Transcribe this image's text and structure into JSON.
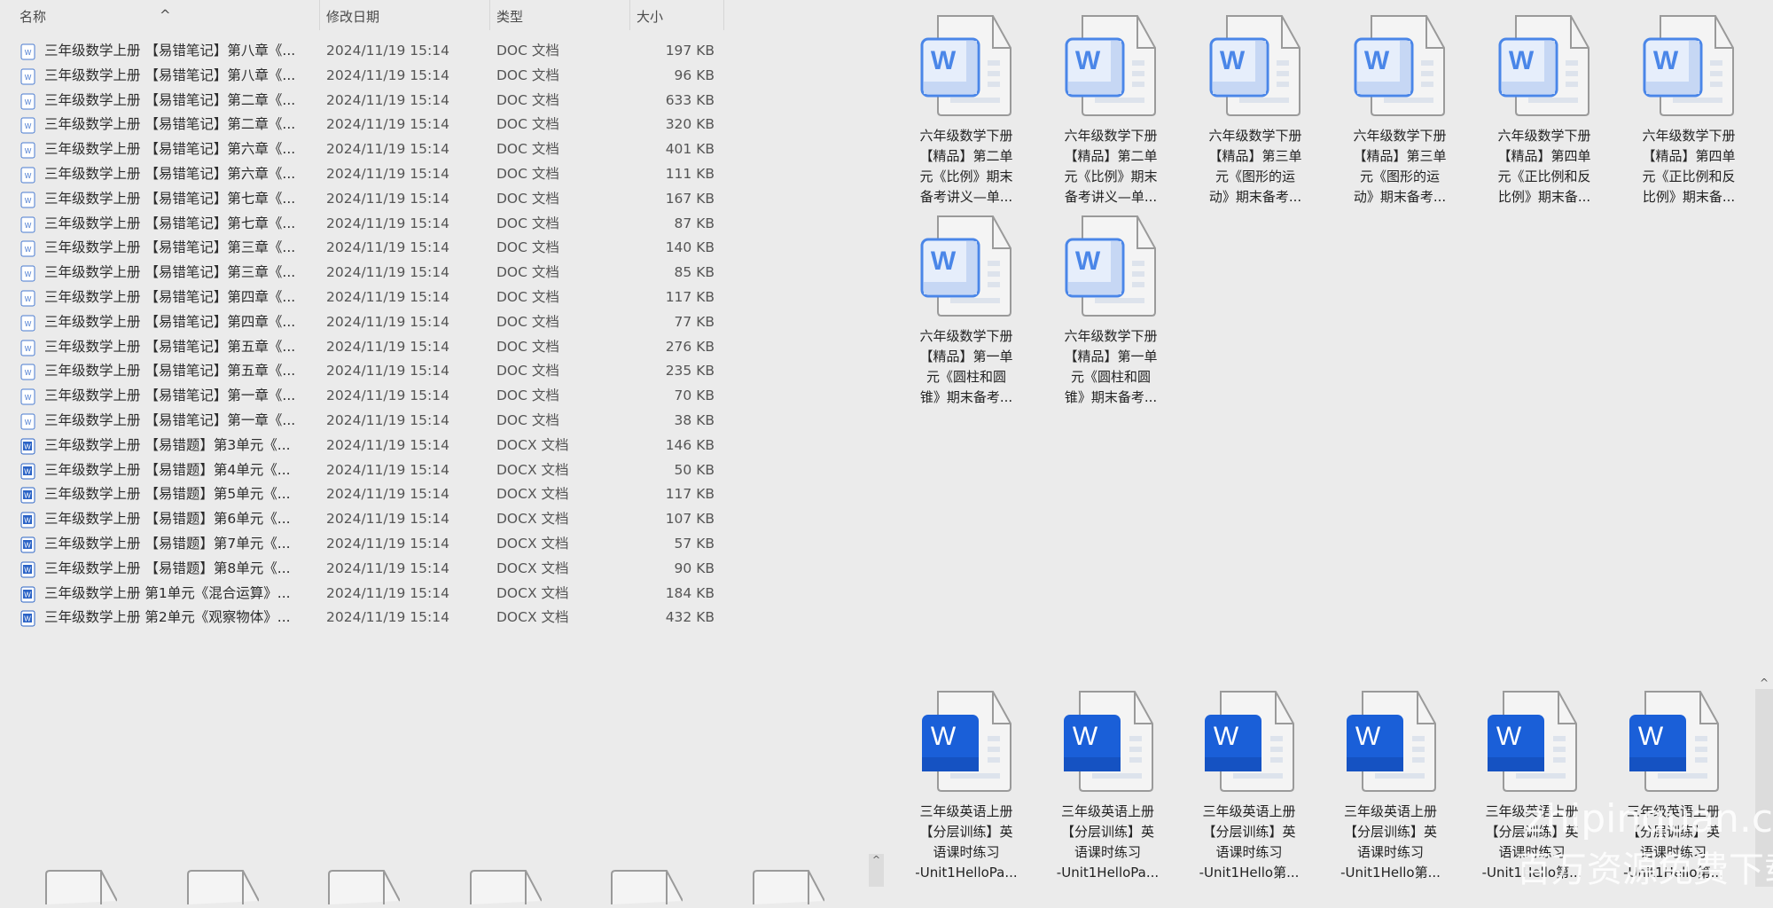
{
  "list": {
    "columns": {
      "name": "名称",
      "date": "修改日期",
      "type": "类型",
      "size": "大小"
    },
    "rows": [
      {
        "name": "三年级数学上册 【易错笔记】第八章《...",
        "date": "2024/11/19 15:14",
        "type": "DOC 文档",
        "size": "197 KB",
        "kind": "doc"
      },
      {
        "name": "三年级数学上册 【易错笔记】第八章《...",
        "date": "2024/11/19 15:14",
        "type": "DOC 文档",
        "size": "96 KB",
        "kind": "doc"
      },
      {
        "name": "三年级数学上册 【易错笔记】第二章《...",
        "date": "2024/11/19 15:14",
        "type": "DOC 文档",
        "size": "633 KB",
        "kind": "doc"
      },
      {
        "name": "三年级数学上册 【易错笔记】第二章《...",
        "date": "2024/11/19 15:14",
        "type": "DOC 文档",
        "size": "320 KB",
        "kind": "doc"
      },
      {
        "name": "三年级数学上册 【易错笔记】第六章《...",
        "date": "2024/11/19 15:14",
        "type": "DOC 文档",
        "size": "401 KB",
        "kind": "doc"
      },
      {
        "name": "三年级数学上册 【易错笔记】第六章《...",
        "date": "2024/11/19 15:14",
        "type": "DOC 文档",
        "size": "111 KB",
        "kind": "doc"
      },
      {
        "name": "三年级数学上册 【易错笔记】第七章《...",
        "date": "2024/11/19 15:14",
        "type": "DOC 文档",
        "size": "167 KB",
        "kind": "doc"
      },
      {
        "name": "三年级数学上册 【易错笔记】第七章《...",
        "date": "2024/11/19 15:14",
        "type": "DOC 文档",
        "size": "87 KB",
        "kind": "doc"
      },
      {
        "name": "三年级数学上册 【易错笔记】第三章《...",
        "date": "2024/11/19 15:14",
        "type": "DOC 文档",
        "size": "140 KB",
        "kind": "doc"
      },
      {
        "name": "三年级数学上册 【易错笔记】第三章《...",
        "date": "2024/11/19 15:14",
        "type": "DOC 文档",
        "size": "85 KB",
        "kind": "doc"
      },
      {
        "name": "三年级数学上册 【易错笔记】第四章《...",
        "date": "2024/11/19 15:14",
        "type": "DOC 文档",
        "size": "117 KB",
        "kind": "doc"
      },
      {
        "name": "三年级数学上册 【易错笔记】第四章《...",
        "date": "2024/11/19 15:14",
        "type": "DOC 文档",
        "size": "77 KB",
        "kind": "doc"
      },
      {
        "name": "三年级数学上册 【易错笔记】第五章《...",
        "date": "2024/11/19 15:14",
        "type": "DOC 文档",
        "size": "276 KB",
        "kind": "doc"
      },
      {
        "name": "三年级数学上册 【易错笔记】第五章《...",
        "date": "2024/11/19 15:14",
        "type": "DOC 文档",
        "size": "235 KB",
        "kind": "doc"
      },
      {
        "name": "三年级数学上册 【易错笔记】第一章《...",
        "date": "2024/11/19 15:14",
        "type": "DOC 文档",
        "size": "70 KB",
        "kind": "doc"
      },
      {
        "name": "三年级数学上册 【易错笔记】第一章《...",
        "date": "2024/11/19 15:14",
        "type": "DOC 文档",
        "size": "38 KB",
        "kind": "doc"
      },
      {
        "name": "三年级数学上册 【易错题】第3单元《...",
        "date": "2024/11/19 15:14",
        "type": "DOCX 文档",
        "size": "146 KB",
        "kind": "docx"
      },
      {
        "name": "三年级数学上册 【易错题】第4单元《...",
        "date": "2024/11/19 15:14",
        "type": "DOCX 文档",
        "size": "50 KB",
        "kind": "docx"
      },
      {
        "name": "三年级数学上册 【易错题】第5单元《...",
        "date": "2024/11/19 15:14",
        "type": "DOCX 文档",
        "size": "117 KB",
        "kind": "docx"
      },
      {
        "name": "三年级数学上册 【易错题】第6单元《...",
        "date": "2024/11/19 15:14",
        "type": "DOCX 文档",
        "size": "107 KB",
        "kind": "docx"
      },
      {
        "name": "三年级数学上册 【易错题】第7单元《...",
        "date": "2024/11/19 15:14",
        "type": "DOCX 文档",
        "size": "57 KB",
        "kind": "docx"
      },
      {
        "name": "三年级数学上册 【易错题】第8单元《...",
        "date": "2024/11/19 15:14",
        "type": "DOCX 文档",
        "size": "90 KB",
        "kind": "docx"
      },
      {
        "name": "三年级数学上册 第1单元《混合运算》...",
        "date": "2024/11/19 15:14",
        "type": "DOCX 文档",
        "size": "184 KB",
        "kind": "docx"
      },
      {
        "name": "三年级数学上册 第2单元《观察物体》...",
        "date": "2024/11/19 15:14",
        "type": "DOCX 文档",
        "size": "432 KB",
        "kind": "docx"
      }
    ]
  },
  "grid_top": [
    [
      "六年级数学下册",
      "【精品】第二单",
      "元《比例》期末",
      "备考讲义—单..."
    ],
    [
      "六年级数学下册",
      "【精品】第二单",
      "元《比例》期末",
      "备考讲义—单..."
    ],
    [
      "六年级数学下册",
      "【精品】第三单",
      "元《图形的运",
      "动》期末备考..."
    ],
    [
      "六年级数学下册",
      "【精品】第三单",
      "元《图形的运",
      "动》期末备考..."
    ],
    [
      "六年级数学下册",
      "【精品】第四单",
      "元《正比例和反",
      "比例》期末备..."
    ],
    [
      "六年级数学下册",
      "【精品】第四单",
      "元《正比例和反",
      "比例》期末备..."
    ],
    [
      "六年级数学下册",
      "【精品】第一单",
      "元《圆柱和圆",
      "锥》期末备考..."
    ],
    [
      "六年级数学下册",
      "【精品】第一单",
      "元《圆柱和圆",
      "锥》期末备考..."
    ]
  ],
  "grid_bottom": [
    [
      "三年级英语上册",
      "【分层训练】英",
      "语课时练习",
      "-Unit1HelloPa..."
    ],
    [
      "三年级英语上册",
      "【分层训练】英",
      "语课时练习",
      "-Unit1HelloPa..."
    ],
    [
      "三年级英语上册",
      "【分层训练】英",
      "语课时练习",
      "-Unit1Hello第..."
    ],
    [
      "三年级英语上册",
      "【分层训练】英",
      "语课时练习",
      "-Unit1Hello第..."
    ],
    [
      "三年级英语上册",
      "【分层训练】英",
      "语课时练习",
      "-Unit1Hello第..."
    ],
    [
      "三年级英语上册",
      "【分层训练】英",
      "语课时练习",
      "-Unit1Hello第..."
    ]
  ],
  "watermark": {
    "line1": "zhipinquan.com",
    "line2": "百万资源免费下载"
  },
  "colors": {
    "word_light": "#4a86e8",
    "word_solid": "#1a5fd8"
  }
}
